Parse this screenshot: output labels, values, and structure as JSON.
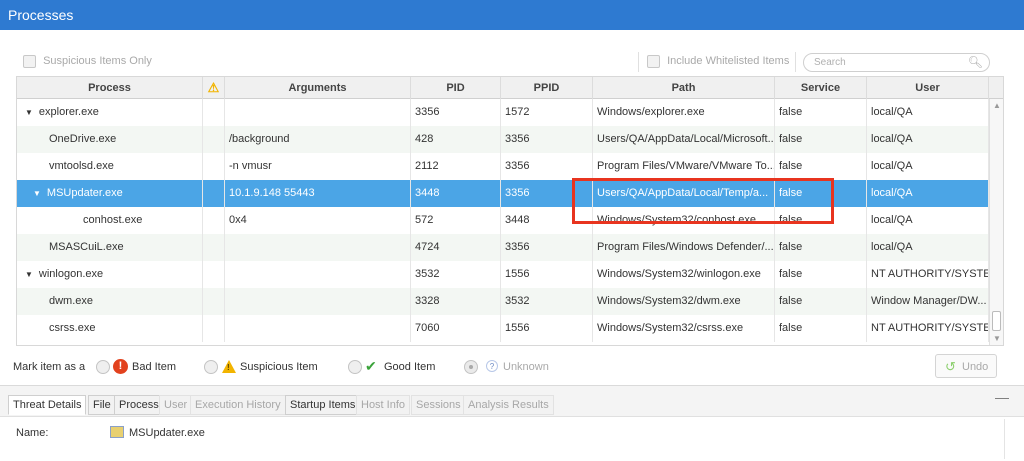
{
  "window": {
    "title": "Processes"
  },
  "filters": {
    "suspicious_only_label": "Suspicious Items Only",
    "include_whitelisted_label": "Include Whitelisted Items",
    "search_placeholder": "Search"
  },
  "table": {
    "columns": {
      "process": "Process",
      "arguments": "Arguments",
      "pid": "PID",
      "ppid": "PPID",
      "path": "Path",
      "service": "Service",
      "user": "User"
    },
    "rows": [
      {
        "tree": "▼",
        "process": "explorer.exe",
        "arguments": "",
        "pid": "3356",
        "ppid": "1572",
        "path": "Windows/explorer.exe",
        "service": "false",
        "user": "local/QA"
      },
      {
        "tree": "",
        "process": "OneDrive.exe",
        "arguments": "/background",
        "pid": "428",
        "ppid": "3356",
        "path": "Users/QA/AppData/Local/Microsoft...",
        "service": "false",
        "user": "local/QA"
      },
      {
        "tree": "",
        "process": "vmtoolsd.exe",
        "arguments": "-n vmusr",
        "pid": "2112",
        "ppid": "3356",
        "path": "Program Files/VMware/VMware To...",
        "service": "false",
        "user": "local/QA"
      },
      {
        "tree": "▼",
        "process": "MSUpdater.exe",
        "arguments": "10.1.9.148 55443",
        "pid": "3448",
        "ppid": "3356",
        "path": "Users/QA/AppData/Local/Temp/a...",
        "service": "false",
        "user": "local/QA"
      },
      {
        "tree": "",
        "process": "conhost.exe",
        "arguments": "0x4",
        "pid": "572",
        "ppid": "3448",
        "path": "Windows/System32/conhost.exe",
        "service": "false",
        "user": "local/QA"
      },
      {
        "tree": "",
        "process": "MSASCuiL.exe",
        "arguments": "",
        "pid": "4724",
        "ppid": "3356",
        "path": "Program Files/Windows Defender/...",
        "service": "false",
        "user": "local/QA"
      },
      {
        "tree": "▼",
        "process": "winlogon.exe",
        "arguments": "",
        "pid": "3532",
        "ppid": "1556",
        "path": "Windows/System32/winlogon.exe",
        "service": "false",
        "user": "NT AUTHORITY/SYSTEM"
      },
      {
        "tree": "",
        "process": "dwm.exe",
        "arguments": "",
        "pid": "3328",
        "ppid": "3532",
        "path": "Windows/System32/dwm.exe",
        "service": "false",
        "user": "Window Manager/DW..."
      },
      {
        "tree": "",
        "process": "csrss.exe",
        "arguments": "",
        "pid": "7060",
        "ppid": "1556",
        "path": "Windows/System32/csrss.exe",
        "service": "false",
        "user": "NT AUTHORITY/SYSTEM"
      }
    ]
  },
  "mark": {
    "prefix": "Mark item as a",
    "bad_label": "Bad Item",
    "suspicious_label": "Suspicious Item",
    "good_label": "Good Item",
    "unknown_label": "Unknown",
    "undo_label": "Undo"
  },
  "tabs": [
    "Threat Details",
    "File",
    "Process",
    "User",
    "Execution History",
    "Startup Items",
    "Host Info",
    "Sessions",
    "Analysis Results"
  ],
  "details": {
    "name_label": "Name:",
    "name_value": "MSUpdater.exe"
  },
  "colors": {
    "titlebar": "#2e7ad1",
    "selected_row": "#4ba5e6",
    "highlight_box": "#e8341f"
  }
}
